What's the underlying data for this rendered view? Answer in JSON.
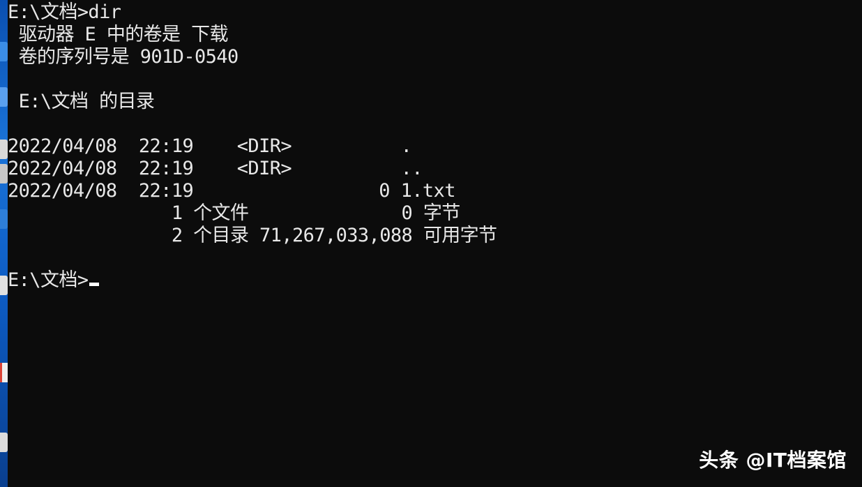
{
  "console": {
    "lines": [
      "E:\\文档>dir",
      " 驱动器 E 中的卷是 下载",
      " 卷的序列号是 901D-0540",
      "",
      " E:\\文档 的目录",
      "",
      "2022/04/08  22:19    <DIR>          .",
      "2022/04/08  22:19    <DIR>          ..",
      "2022/04/08  22:19                 0 1.txt",
      "               1 个文件              0 字节",
      "               2 个目录 71,267,033,088 可用字节",
      "",
      "E:\\文档>"
    ]
  },
  "watermark": {
    "text": "头条 @IT档案馆"
  },
  "colors": {
    "background": "#0c0c0c",
    "foreground": "#e8e8e8",
    "desktop_strip": "#1a73d8"
  }
}
